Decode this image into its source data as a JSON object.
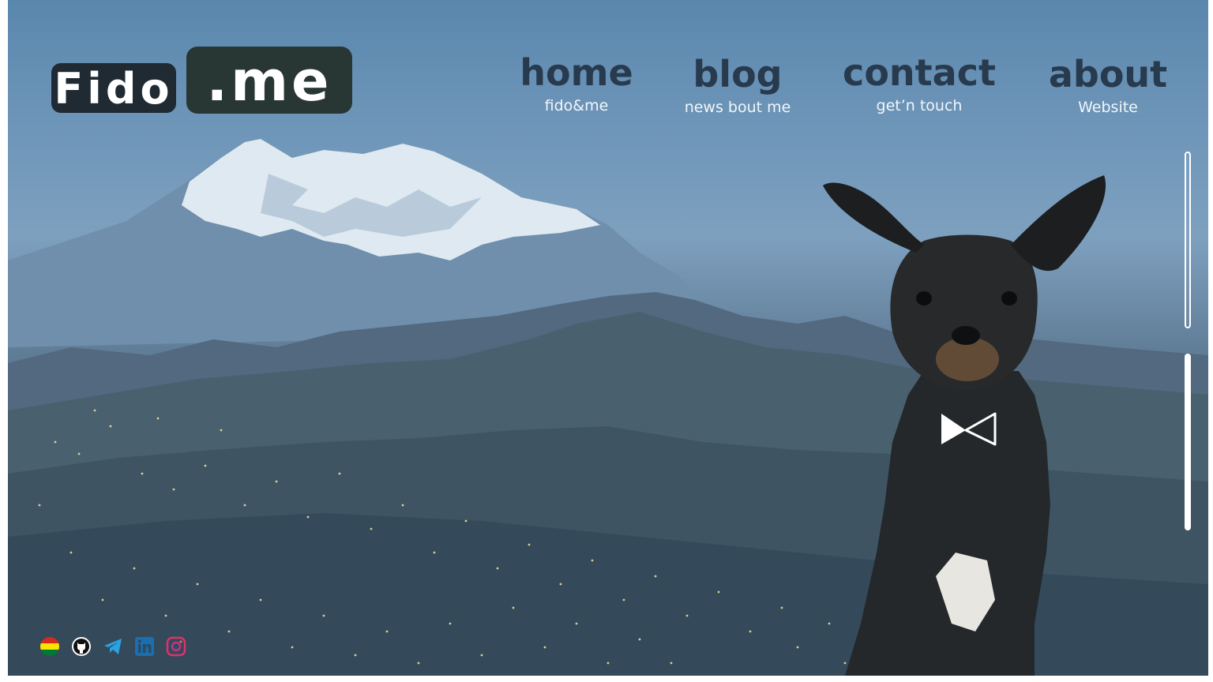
{
  "logo": {
    "part1": "Fido",
    "part2": ".me"
  },
  "nav": [
    {
      "title": "home",
      "subtitle": "fido&me"
    },
    {
      "title": "blog",
      "subtitle": "news bout me"
    },
    {
      "title": "contact",
      "subtitle": "get’n touch"
    },
    {
      "title": "about",
      "subtitle": "Website"
    }
  ],
  "socials": [
    "bolivia-flag-icon",
    "github-icon",
    "telegram-icon",
    "linkedin-icon",
    "instagram-icon"
  ],
  "colors": {
    "sky": "#5a87ad",
    "logo_dark": "#1f2a33",
    "logo_green": "#283634",
    "nav_title": "#283a4d",
    "nav_subtitle": "#f2f6fa"
  }
}
